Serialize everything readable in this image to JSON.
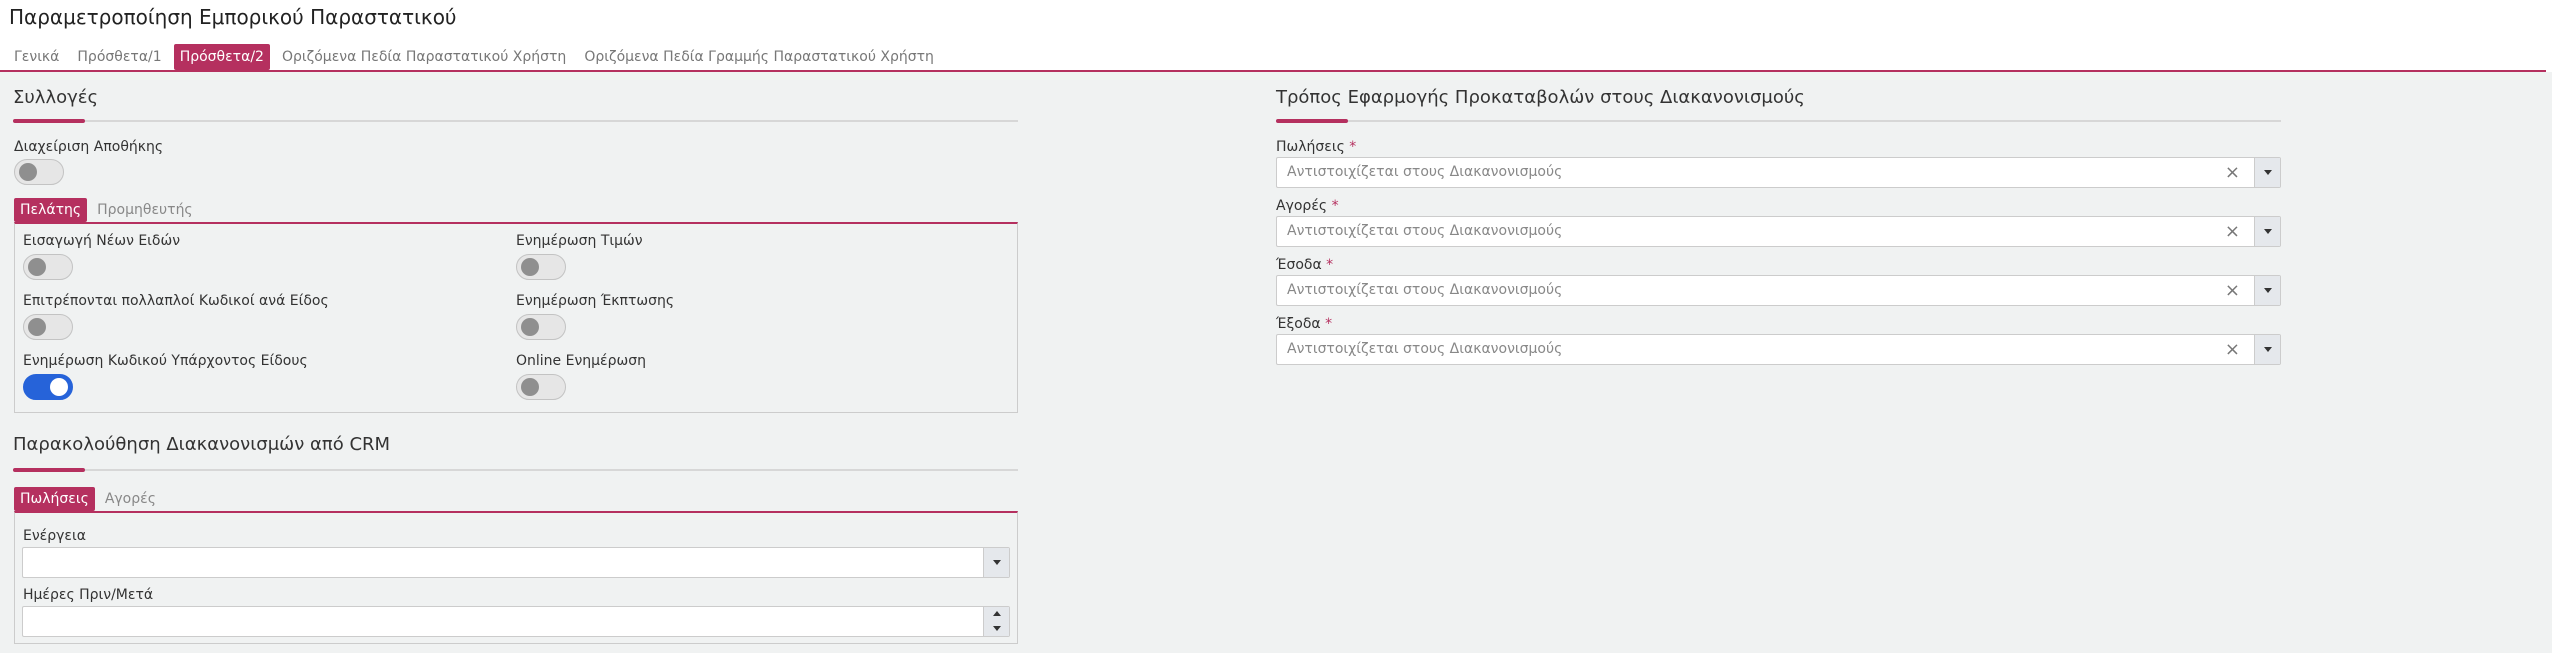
{
  "page": {
    "title": "Παραμετροποίηση Εμπορικού Παραστατικού"
  },
  "tabs": [
    {
      "label": "Γενικά",
      "active": false
    },
    {
      "label": "Πρόσθετα/1",
      "active": false
    },
    {
      "label": "Πρόσθετα/2",
      "active": true
    },
    {
      "label": "Οριζόμενα Πεδία Παραστατικού Χρήστη",
      "active": false
    },
    {
      "label": "Οριζόμενα Πεδία Γραμμής Παραστατικού Χρήστη",
      "active": false
    }
  ],
  "collections": {
    "title": "Συλλογές",
    "warehouse_label": "Διαχείριση Αποθήκης",
    "warehouse_on": false,
    "subtabs": [
      {
        "label": "Πελάτης",
        "active": true
      },
      {
        "label": "Προμηθευτής",
        "active": false
      }
    ],
    "toggles": [
      {
        "label": "Εισαγωγή Νέων Ειδών",
        "on": false
      },
      {
        "label": "Ενημέρωση Τιμών",
        "on": false
      },
      {
        "label": "Επιτρέπονται πολλαπλοί Κωδικοί ανά Είδος",
        "on": false
      },
      {
        "label": "Ενημέρωση Έκπτωσης",
        "on": false
      },
      {
        "label": "Ενημέρωση Κωδικού Υπάρχοντος Είδους",
        "on": true
      },
      {
        "label": "Online Ενημέρωση",
        "on": false
      }
    ]
  },
  "crm": {
    "title": "Παρακολούθηση Διακανονισμών από CRM",
    "subtabs": [
      {
        "label": "Πωλήσεις",
        "active": true
      },
      {
        "label": "Αγορές",
        "active": false
      }
    ],
    "action_label": "Ενέργεια",
    "action_value": "",
    "days_label": "Ημέρες Πριν/Μετά",
    "days_value": ""
  },
  "advances": {
    "title": "Τρόπος Εφαρμογής Προκαταβολών στους Διακανονισμούς",
    "required_mark": "*",
    "fields": [
      {
        "label": "Πωλήσεις",
        "value": "Αντιστοιχίζεται στους Διακανονισμούς"
      },
      {
        "label": "Αγορές",
        "value": "Αντιστοιχίζεται στους Διακανονισμούς"
      },
      {
        "label": "Έσοδα",
        "value": "Αντιστοιχίζεται στους Διακανονισμούς"
      },
      {
        "label": "Έξοδα",
        "value": "Αντιστοιχίζεται στους Διακανονισμούς"
      }
    ],
    "clear_glyph": "×"
  },
  "colors": {
    "accent": "#b5305f",
    "toggle_on": "#2663d9",
    "background": "#f0f2f2"
  }
}
